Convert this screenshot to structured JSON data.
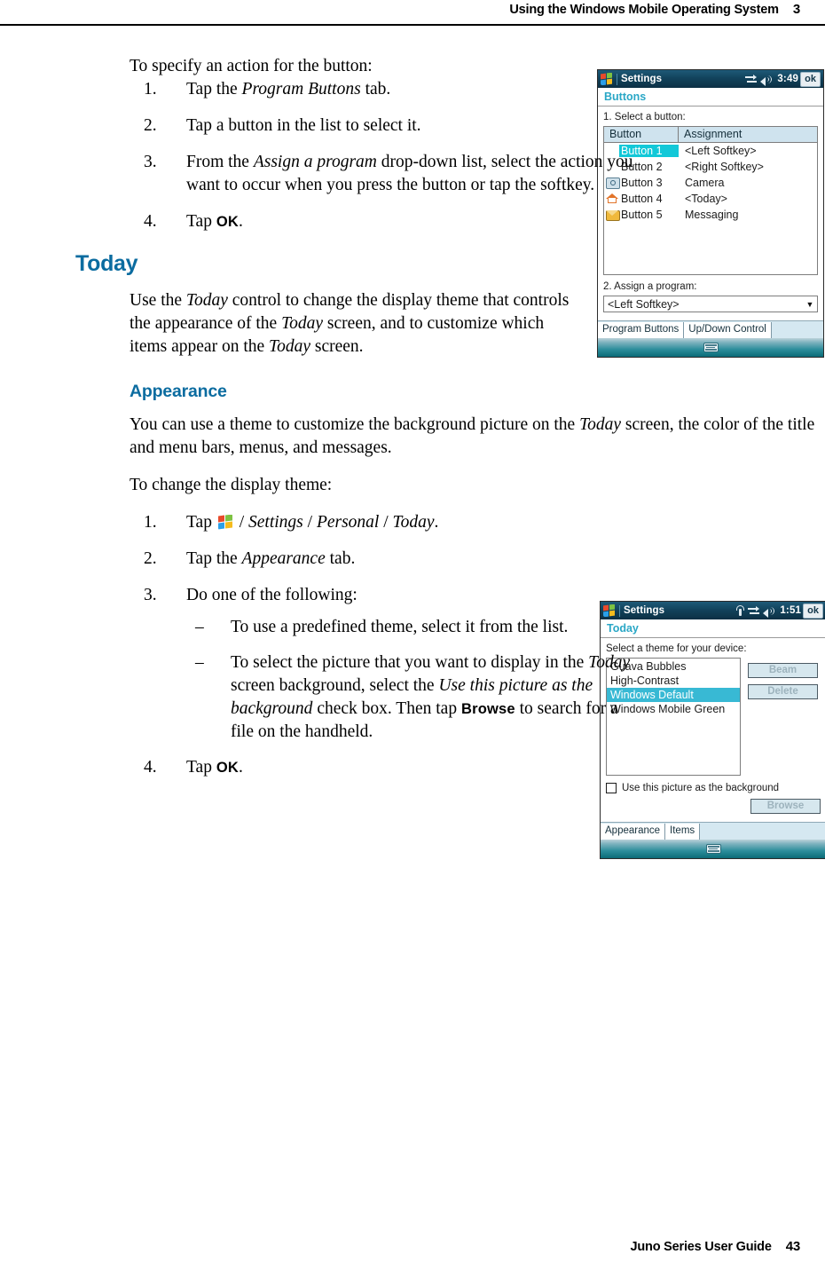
{
  "header": {
    "title": "Using the Windows Mobile Operating System",
    "chapter": "3"
  },
  "footer": {
    "guide": "Juno Series User Guide",
    "page": "43"
  },
  "body": {
    "intro_buttons": "To specify an action for the button:",
    "steps_buttons": [
      {
        "num": "1.",
        "pre": "Tap the ",
        "em": "Program Buttons",
        "post": " tab."
      },
      {
        "num": "2.",
        "pre": "Tap a button in the list to select it.",
        "em": "",
        "post": ""
      },
      {
        "num": "3.",
        "pre": "From the ",
        "em": "Assign a program",
        "post": " drop-down list, select the action you want to occur when you press the button or tap the softkey."
      },
      {
        "num": "4.",
        "pre": "Tap ",
        "em": "",
        "post": "."
      }
    ],
    "step4_ok": "OK",
    "today_heading": "Today",
    "today_para_1": "Use the ",
    "today_para_em1": "Today",
    "today_para_2": " control to change the display theme that controls the appearance of the ",
    "today_para_em2": "Today",
    "today_para_3": " screen, and to customize which items appear on the ",
    "today_para_em3": "Today",
    "today_para_4": " screen.",
    "appearance_heading": "Appearance",
    "appearance_para_1": "You can use a theme to customize the background picture on the ",
    "appearance_para_em1": "Today",
    "appearance_para_2": " screen, the color of the title and menu bars, menus, and messages.",
    "change_theme_lead": "To change the display theme:",
    "theme_steps": [
      {
        "num": "1.",
        "text_a": "Tap ",
        "text_b": " / ",
        "em1": "Settings",
        "sep1": " / ",
        "em2": "Personal",
        "sep2": " / ",
        "em3": "Today",
        "tail": "."
      },
      {
        "num": "2.",
        "pre": "Tap the ",
        "em": "Appearance",
        "post": " tab."
      },
      {
        "num": "3.",
        "pre": "Do one of the following:",
        "em": "",
        "post": ""
      },
      {
        "num": "4.",
        "pre": "Tap ",
        "em": "",
        "post": "."
      }
    ],
    "theme_substeps": [
      {
        "dash": "–",
        "text": "To use a predefined theme, select it from the list."
      },
      {
        "dash": "–",
        "p1": "To select the picture that you want to display in the ",
        "em1": "Today",
        "p2": " screen background, select the ",
        "em2": "Use this picture as the background",
        "p3": " check box. Then tap ",
        "bold": "Browse",
        "p4": " to search for a file on the handheld."
      }
    ],
    "icon_start": "windows-start-flag-icon"
  },
  "device_buttons": {
    "titlebar": {
      "app": "Settings",
      "time": "3:49",
      "ok": "ok",
      "icons": [
        "connectivity-icon",
        "speaker-icon"
      ]
    },
    "subtitle": "Buttons",
    "label_1": "1. Select a button:",
    "table": {
      "columns": [
        "Button",
        "Assignment"
      ],
      "rows": [
        {
          "icon": "",
          "name": "Button 1",
          "assignment": "<Left Softkey>",
          "selected": true
        },
        {
          "icon": "",
          "name": "Button 2",
          "assignment": "<Right Softkey>",
          "selected": false
        },
        {
          "icon": "camera-icon",
          "name": "Button 3",
          "assignment": "Camera",
          "selected": false
        },
        {
          "icon": "home-icon",
          "name": "Button 4",
          "assignment": "<Today>",
          "selected": false
        },
        {
          "icon": "mail-icon",
          "name": "Button 5",
          "assignment": "Messaging",
          "selected": false
        }
      ]
    },
    "label_2": "2. Assign a program:",
    "dropdown_value": "<Left Softkey>",
    "tabs": [
      {
        "label": "Program Buttons",
        "active": true
      },
      {
        "label": "Up/Down Control",
        "active": false
      }
    ]
  },
  "device_today": {
    "titlebar": {
      "app": "Settings",
      "time": "1:51",
      "ok": "ok",
      "icons": [
        "antenna-icon",
        "connectivity-icon",
        "speaker-icon"
      ]
    },
    "subtitle": "Today",
    "label": "Select a theme for your device:",
    "themes": [
      {
        "label": "Guava Bubbles",
        "selected": false
      },
      {
        "label": "High-Contrast",
        "selected": false
      },
      {
        "label": "Windows Default",
        "selected": true
      },
      {
        "label": "Windows Mobile Green",
        "selected": false
      }
    ],
    "buttons": [
      {
        "label": "Beam",
        "disabled": true
      },
      {
        "label": "Delete",
        "disabled": true
      }
    ],
    "checkbox": {
      "label": "Use this picture as the background",
      "checked": false
    },
    "browse_button": {
      "label": "Browse",
      "disabled": true
    },
    "tabs": [
      {
        "label": "Appearance",
        "active": true
      },
      {
        "label": "Items",
        "active": false
      }
    ]
  },
  "colors": {
    "heading": "#0b6ca0",
    "device_subtitle": "#2aa7c6",
    "selection_cyan": "#12c8d8",
    "theme_selection": "#38b9d4",
    "table_header": "#cfe3ee"
  }
}
